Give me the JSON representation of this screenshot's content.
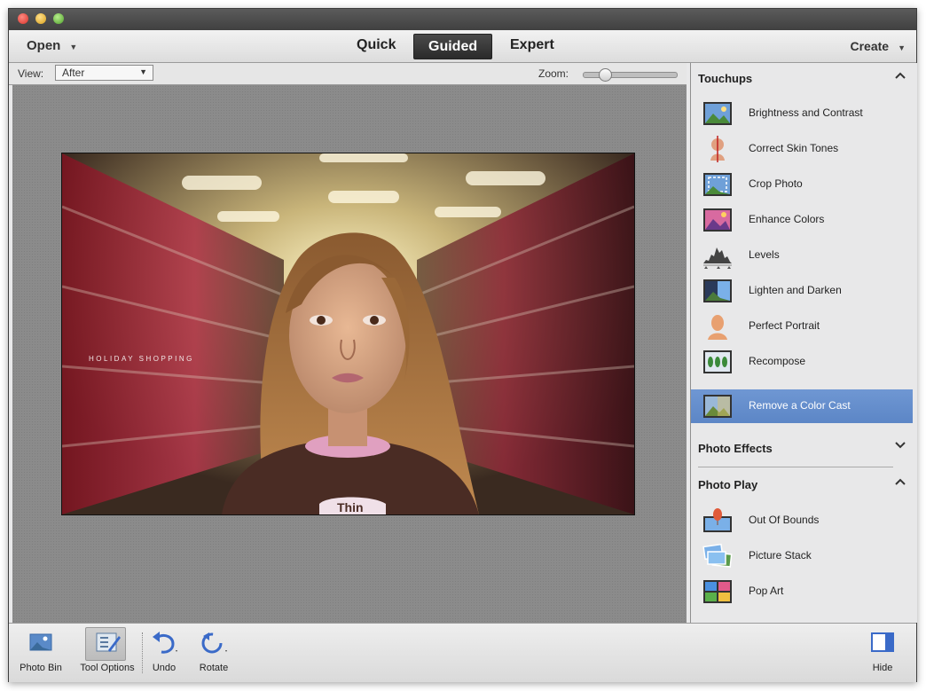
{
  "menubar": {
    "open_label": "Open",
    "create_label": "Create",
    "modes": [
      "Quick",
      "Guided",
      "Expert"
    ],
    "active_mode": "Guided"
  },
  "options": {
    "view_label": "View:",
    "view_value": "After",
    "zoom_label": "Zoom:",
    "zoom_level_fraction": 0.18
  },
  "photo": {
    "caption": "HOLIDAY SHOPPING",
    "shirt_text": "Thin"
  },
  "panel": {
    "touchups": {
      "title": "Touchups",
      "expanded": true,
      "items": [
        {
          "label": "Brightness and Contrast",
          "icon": "brightness-contrast-icon"
        },
        {
          "label": "Correct Skin Tones",
          "icon": "skin-tone-icon"
        },
        {
          "label": "Crop Photo",
          "icon": "crop-photo-icon"
        },
        {
          "label": "Enhance Colors",
          "icon": "enhance-colors-icon"
        },
        {
          "label": "Levels",
          "icon": "levels-icon"
        },
        {
          "label": "Lighten and Darken",
          "icon": "lighten-darken-icon"
        },
        {
          "label": "Perfect Portrait",
          "icon": "perfect-portrait-icon"
        },
        {
          "label": "Recompose",
          "icon": "recompose-icon"
        },
        {
          "label": "Remove a Color Cast",
          "icon": "remove-color-cast-icon",
          "selected": true
        }
      ]
    },
    "photo_effects": {
      "title": "Photo Effects",
      "expanded": false
    },
    "photo_play": {
      "title": "Photo Play",
      "expanded": true,
      "items": [
        {
          "label": "Out Of Bounds",
          "icon": "out-of-bounds-icon"
        },
        {
          "label": "Picture Stack",
          "icon": "picture-stack-icon"
        },
        {
          "label": "Pop Art",
          "icon": "pop-art-icon"
        }
      ]
    }
  },
  "bottombar": {
    "photo_bin": "Photo Bin",
    "tool_options": "Tool Options",
    "undo": "Undo",
    "rotate": "Rotate",
    "hide": "Hide"
  },
  "colors": {
    "selection": "#5c86c6",
    "canvas": "#8b8b8b",
    "panel": "#e8e8e9"
  }
}
